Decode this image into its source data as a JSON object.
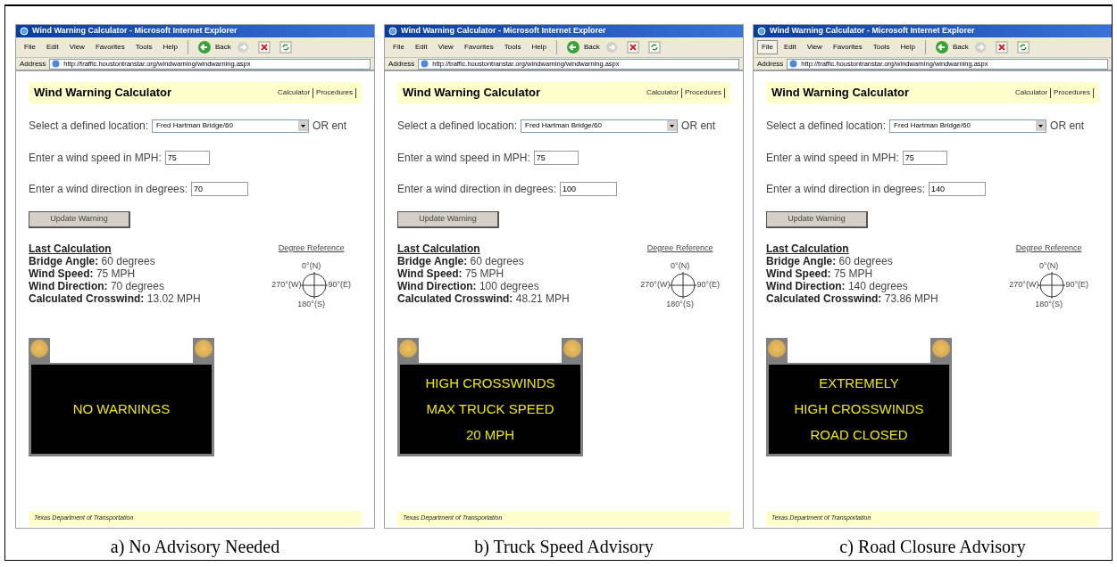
{
  "panels": [
    {
      "browser": {
        "title": "Wind Warning Calculator - Microsoft Internet Explorer",
        "menus": [
          {
            "label": "File",
            "selected": false
          },
          {
            "label": "Edit",
            "selected": false
          },
          {
            "label": "View",
            "selected": false
          },
          {
            "label": "Favorites",
            "selected": false
          },
          {
            "label": "Tools",
            "selected": false
          },
          {
            "label": "Help",
            "selected": false
          }
        ],
        "back": "Back",
        "address_label": "Address",
        "url": "http://traffic.houstontranstar.org/windwarning/windwarning.aspx"
      },
      "page": {
        "heading": "Wind Warning Calculator",
        "nav": [
          "Calculator",
          "Procedures"
        ],
        "location_label": "Select a defined location:",
        "location_value": "Fred Hartman Bridge/60",
        "or_text": "OR ent",
        "speed_label": "Enter a wind speed in MPH:",
        "speed_value": "75",
        "direction_label": "Enter a wind direction in degrees:",
        "direction_value": "70",
        "button": "Update Warning",
        "last_calc_heading": "Last Calculation",
        "results": [
          {
            "label": "Bridge Angle:",
            "value": "60 degrees"
          },
          {
            "label": "Wind Speed:",
            "value": "75 MPH"
          },
          {
            "label": "Wind Direction:",
            "value": "70 degrees"
          },
          {
            "label": "Calculated Crosswind:",
            "value": "13.02 MPH"
          }
        ],
        "degree_reference": {
          "title": "Degree Reference",
          "north": "0°(N)",
          "west": "270°(W)",
          "east": "90°(E)",
          "south": "180°(S)"
        },
        "sign_lines": [
          "NO WARNINGS"
        ],
        "footer": "Texas Department of Transportation"
      },
      "caption": "a) No Advisory Needed"
    },
    {
      "browser": {
        "title": "Wind Warning Calculator - Microsoft Internet Explorer",
        "menus": [
          {
            "label": "File",
            "selected": false
          },
          {
            "label": "Edit",
            "selected": false
          },
          {
            "label": "View",
            "selected": false
          },
          {
            "label": "Favorites",
            "selected": false
          },
          {
            "label": "Tools",
            "selected": false
          },
          {
            "label": "Help",
            "selected": false
          }
        ],
        "back": "Back",
        "address_label": "Address",
        "url": "http://traffic.houstontranstar.org/windwarning/windwarning.aspx"
      },
      "page": {
        "heading": "Wind Warning Calculator",
        "nav": [
          "Calculator",
          "Procedures"
        ],
        "location_label": "Select a defined location:",
        "location_value": "Fred Hartman Bridge/60",
        "or_text": "OR ent",
        "speed_label": "Enter a wind speed in MPH:",
        "speed_value": "75",
        "direction_label": "Enter a wind direction in degrees:",
        "direction_value": "100",
        "button": "Update Warning",
        "last_calc_heading": "Last Calculation",
        "results": [
          {
            "label": "Bridge Angle:",
            "value": "60 degrees"
          },
          {
            "label": "Wind Speed:",
            "value": "75 MPH"
          },
          {
            "label": "Wind Direction:",
            "value": "100 degrees"
          },
          {
            "label": "Calculated Crosswind:",
            "value": "48.21 MPH"
          }
        ],
        "degree_reference": {
          "title": "Degree Reference",
          "north": "0°(N)",
          "west": "270°(W)",
          "east": "90°(E)",
          "south": "180°(S)"
        },
        "sign_lines": [
          "HIGH CROSSWINDS",
          "MAX TRUCK SPEED",
          "20 MPH"
        ],
        "footer": "Texas Department of Transportation"
      },
      "caption": "b) Truck Speed Advisory"
    },
    {
      "browser": {
        "title": "Wind Warning Calculator - Microsoft Internet Explorer",
        "menus": [
          {
            "label": "File",
            "selected": true
          },
          {
            "label": "Edit",
            "selected": false
          },
          {
            "label": "View",
            "selected": false
          },
          {
            "label": "Favorites",
            "selected": false
          },
          {
            "label": "Tools",
            "selected": false
          },
          {
            "label": "Help",
            "selected": false
          }
        ],
        "back": "Back",
        "address_label": "Address",
        "url": "http://traffic.houstontranstar.org/windwarning/windwarning.aspx"
      },
      "page": {
        "heading": "Wind Warning Calculator",
        "nav": [
          "Calculator",
          "Procedures"
        ],
        "location_label": "Select a defined location:",
        "location_value": "Fred Hartman Bridge/60",
        "or_text": "OR ent",
        "speed_label": "Enter a wind speed in MPH:",
        "speed_value": "75",
        "direction_label": "Enter a wind direction in degrees:",
        "direction_value": "140",
        "button": "Update Warning",
        "last_calc_heading": "Last Calculation",
        "results": [
          {
            "label": "Bridge Angle:",
            "value": "60 degrees"
          },
          {
            "label": "Wind Speed:",
            "value": "75 MPH"
          },
          {
            "label": "Wind Direction:",
            "value": "140 degrees"
          },
          {
            "label": "Calculated Crosswind:",
            "value": "73.86 MPH"
          }
        ],
        "degree_reference": {
          "title": "Degree Reference",
          "north": "0°(N)",
          "west": "270°(W)",
          "east": "90°(E)",
          "south": "180°(S)"
        },
        "sign_lines": [
          "EXTREMELY",
          "HIGH CROSSWINDS",
          "ROAD CLOSED"
        ],
        "footer": "Texas Department of Transportation"
      },
      "caption": "c) Road Closure Advisory"
    }
  ]
}
